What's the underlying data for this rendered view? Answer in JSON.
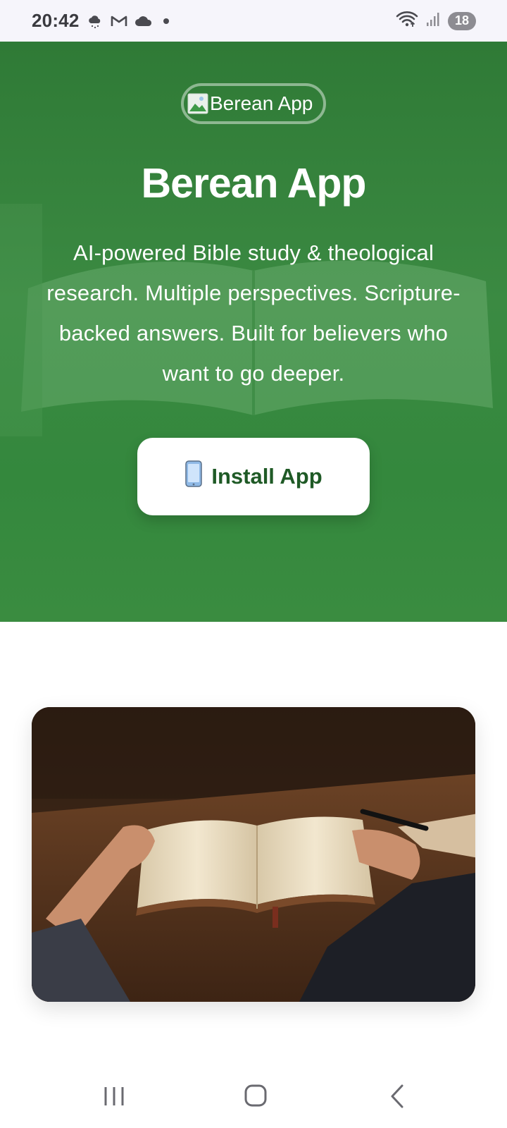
{
  "status_bar": {
    "time": "20:42",
    "icons": [
      "weather-cloud-icon",
      "gmail-icon",
      "cloud-icon",
      "dot-icon"
    ],
    "right_icons": [
      "wifi-icon",
      "signal-icon"
    ],
    "battery": "18"
  },
  "hero": {
    "logo_alt": "Berean App",
    "title": "Berean App",
    "description": "AI-powered Bible study & theological research. Multiple perspectives. Scripture-backed answers. Built for believers who want to go deeper.",
    "install_label": "Install App",
    "install_icon": "mobile-phone-icon",
    "colors": {
      "background": "#3a8a40",
      "button_text": "#1f5a26"
    }
  },
  "feature_image": {
    "subject": "open-bible-on-desk-image"
  },
  "nav_bar": {
    "buttons": [
      "recent-apps-icon",
      "home-icon",
      "back-icon"
    ]
  }
}
